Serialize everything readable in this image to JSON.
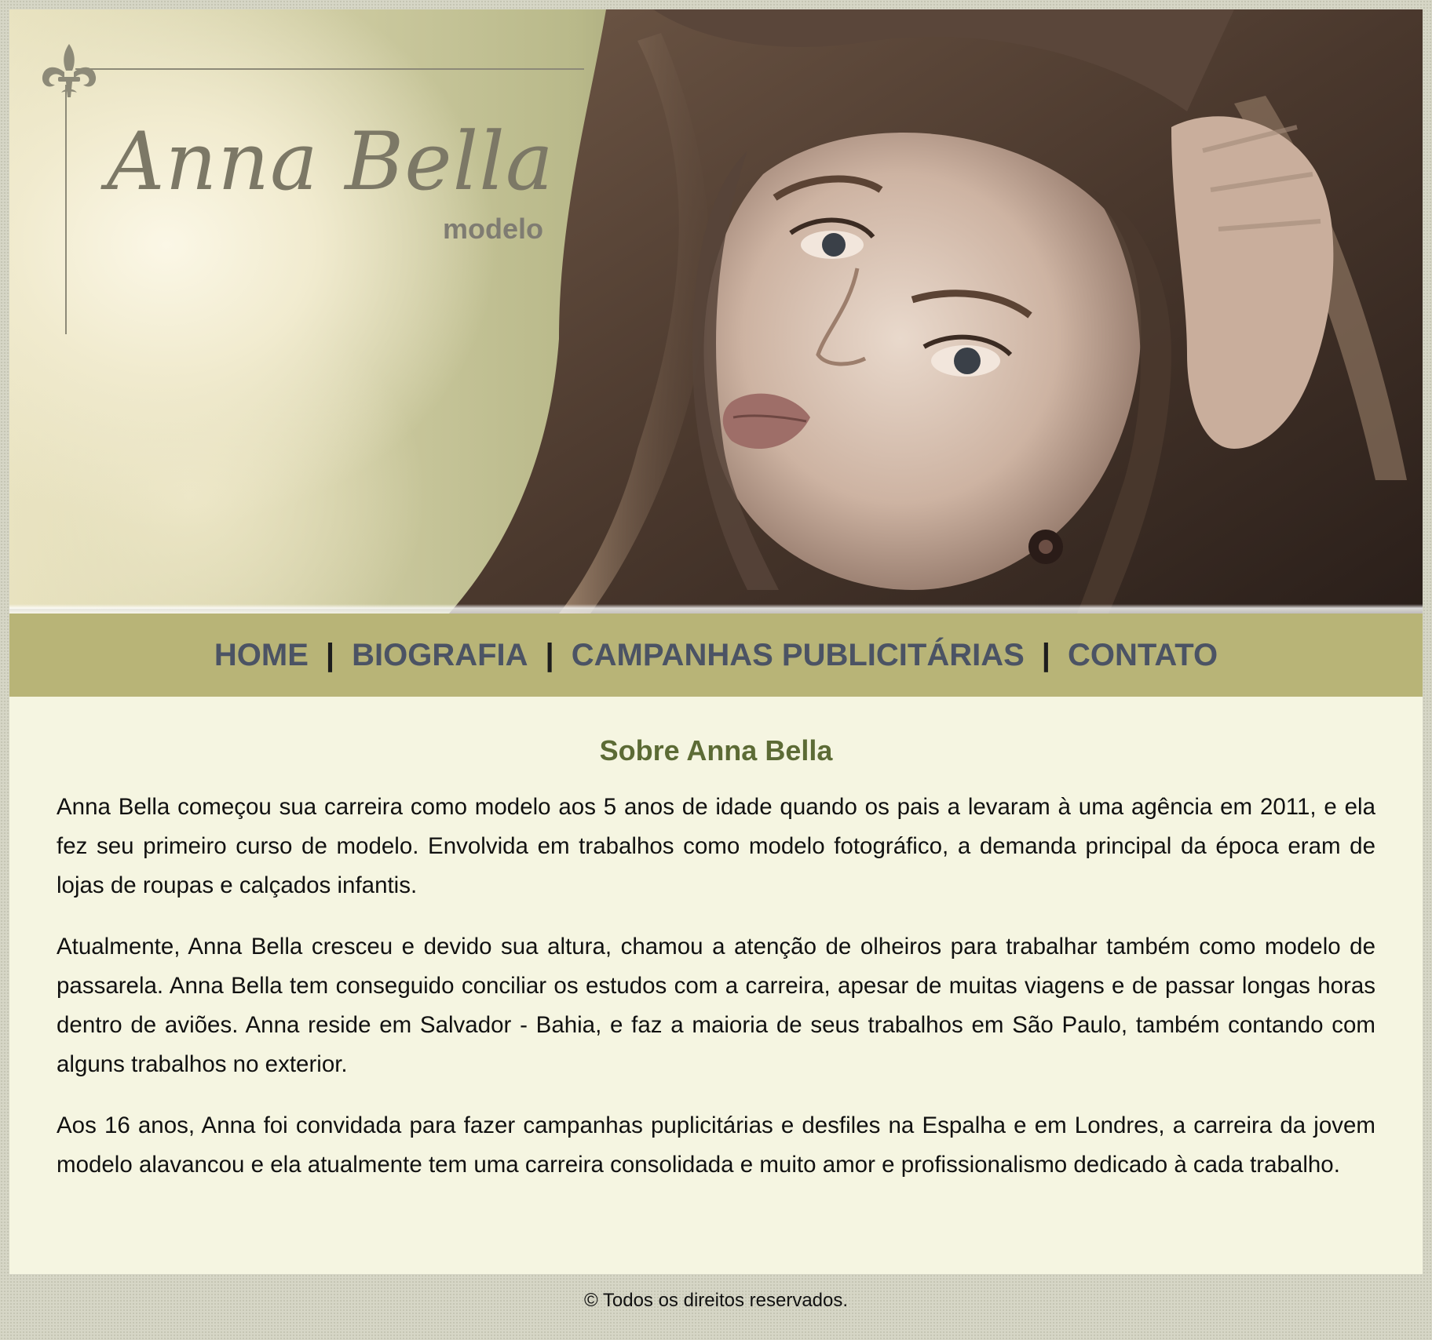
{
  "header": {
    "logo_name": "Anna Bella",
    "logo_subtitle": "modelo"
  },
  "nav": {
    "items": [
      {
        "label": "HOME"
      },
      {
        "label": "BIOGRAFIA"
      },
      {
        "label": "CAMPANHAS PUBLICITÁRIAS"
      },
      {
        "label": "CONTATO"
      }
    ],
    "separator": "|"
  },
  "main": {
    "title": "Sobre Anna Bella",
    "paragraphs": [
      "Anna Bella começou sua carreira como modelo aos 5 anos de idade quando os pais a levaram à uma agência em 2011, e ela fez seu primeiro curso de modelo. Envolvida em trabalhos como modelo fotográfico, a demanda principal da época eram de lojas de roupas e calçados infantis.",
      "Atualmente, Anna Bella cresceu e devido sua altura, chamou a atenção de olheiros para trabalhar também como modelo de passarela. Anna Bella tem conseguido conciliar os estudos com a carreira, apesar de muitas viagens e de passar longas horas dentro de aviões. Anna reside em Salvador - Bahia, e faz a maioria de seus trabalhos em São Paulo, também contando com alguns trabalhos no exterior.",
      "Aos 16 anos, Anna foi convidada para fazer campanhas puplicitárias e desfiles na Espalha e em Londres, a carreira da jovem modelo alavancou e ela atualmente tem uma carreira consolidada e muito amor e profissionalismo dedicado à cada trabalho."
    ]
  },
  "footer": {
    "text": "© Todos os direitos reservados."
  },
  "colors": {
    "nav_background": "#b8b477",
    "nav_link": "#4b5364",
    "title": "#5c6b35",
    "content_background": "#f5f5e1",
    "page_background": "#d6d6c6"
  },
  "icons": {
    "logo_ornament": "fleur-de-lis-icon"
  }
}
